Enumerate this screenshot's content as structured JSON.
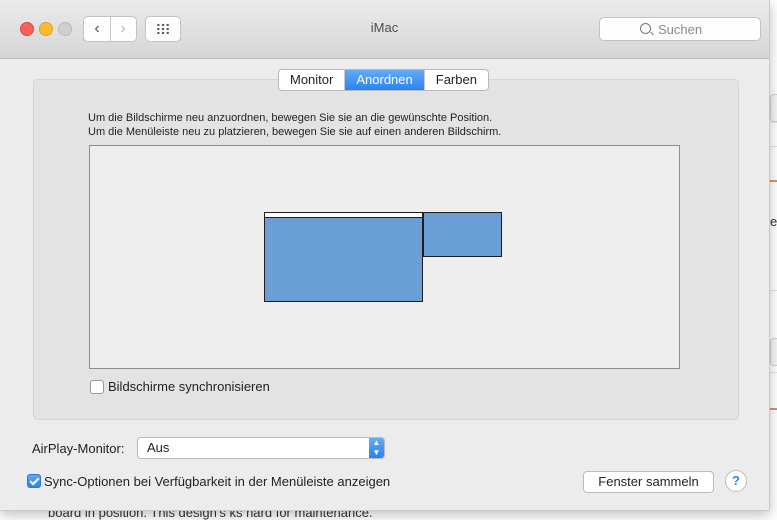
{
  "window": {
    "title": "iMac",
    "search_placeholder": "Suchen",
    "nav_back": "‹",
    "nav_forward": "›"
  },
  "tabs": [
    {
      "label": "Monitor",
      "active": false
    },
    {
      "label": "Anordnen",
      "active": true
    },
    {
      "label": "Farben",
      "active": false
    }
  ],
  "instructions": {
    "line1": "Um die Bildschirme neu anzuordnen, bewegen Sie sie an die gewünschte Position.",
    "line2": "Um die Menüleiste neu zu platzieren, bewegen Sie sie auf einen anderen Bildschirm."
  },
  "mirror": {
    "label": "Bildschirme synchronisieren",
    "checked": false
  },
  "airplay": {
    "label": "AirPlay-Monitor:",
    "value": "Aus"
  },
  "sync_options": {
    "label": "Sync-Optionen bei Verfügbarkeit in der Menüleiste anzeigen",
    "checked": true
  },
  "gather_button": "Fenster sammeln",
  "help_button": "?",
  "background": {
    "text": "board in position. This design's  ks hard for maintenance.",
    "edge_letter": "e"
  },
  "colors": {
    "accent": "#2a83ee",
    "monitor": "#6a9fd6"
  }
}
